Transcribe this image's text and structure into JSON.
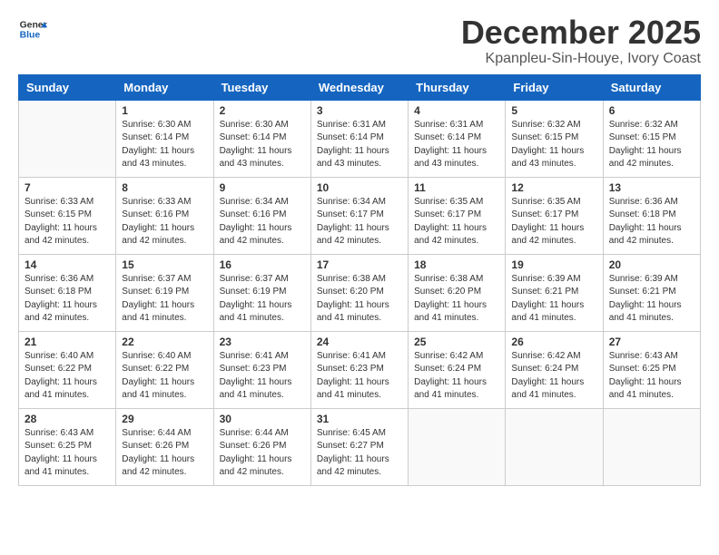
{
  "header": {
    "logo_general": "General",
    "logo_blue": "Blue",
    "title": "December 2025",
    "subtitle": "Kpanpleu-Sin-Houye, Ivory Coast"
  },
  "calendar": {
    "days_of_week": [
      "Sunday",
      "Monday",
      "Tuesday",
      "Wednesday",
      "Thursday",
      "Friday",
      "Saturday"
    ],
    "weeks": [
      [
        {
          "day": "",
          "info": ""
        },
        {
          "day": "1",
          "info": "Sunrise: 6:30 AM\nSunset: 6:14 PM\nDaylight: 11 hours\nand 43 minutes."
        },
        {
          "day": "2",
          "info": "Sunrise: 6:30 AM\nSunset: 6:14 PM\nDaylight: 11 hours\nand 43 minutes."
        },
        {
          "day": "3",
          "info": "Sunrise: 6:31 AM\nSunset: 6:14 PM\nDaylight: 11 hours\nand 43 minutes."
        },
        {
          "day": "4",
          "info": "Sunrise: 6:31 AM\nSunset: 6:14 PM\nDaylight: 11 hours\nand 43 minutes."
        },
        {
          "day": "5",
          "info": "Sunrise: 6:32 AM\nSunset: 6:15 PM\nDaylight: 11 hours\nand 43 minutes."
        },
        {
          "day": "6",
          "info": "Sunrise: 6:32 AM\nSunset: 6:15 PM\nDaylight: 11 hours\nand 42 minutes."
        }
      ],
      [
        {
          "day": "7",
          "info": "Sunrise: 6:33 AM\nSunset: 6:15 PM\nDaylight: 11 hours\nand 42 minutes."
        },
        {
          "day": "8",
          "info": "Sunrise: 6:33 AM\nSunset: 6:16 PM\nDaylight: 11 hours\nand 42 minutes."
        },
        {
          "day": "9",
          "info": "Sunrise: 6:34 AM\nSunset: 6:16 PM\nDaylight: 11 hours\nand 42 minutes."
        },
        {
          "day": "10",
          "info": "Sunrise: 6:34 AM\nSunset: 6:17 PM\nDaylight: 11 hours\nand 42 minutes."
        },
        {
          "day": "11",
          "info": "Sunrise: 6:35 AM\nSunset: 6:17 PM\nDaylight: 11 hours\nand 42 minutes."
        },
        {
          "day": "12",
          "info": "Sunrise: 6:35 AM\nSunset: 6:17 PM\nDaylight: 11 hours\nand 42 minutes."
        },
        {
          "day": "13",
          "info": "Sunrise: 6:36 AM\nSunset: 6:18 PM\nDaylight: 11 hours\nand 42 minutes."
        }
      ],
      [
        {
          "day": "14",
          "info": "Sunrise: 6:36 AM\nSunset: 6:18 PM\nDaylight: 11 hours\nand 42 minutes."
        },
        {
          "day": "15",
          "info": "Sunrise: 6:37 AM\nSunset: 6:19 PM\nDaylight: 11 hours\nand 41 minutes."
        },
        {
          "day": "16",
          "info": "Sunrise: 6:37 AM\nSunset: 6:19 PM\nDaylight: 11 hours\nand 41 minutes."
        },
        {
          "day": "17",
          "info": "Sunrise: 6:38 AM\nSunset: 6:20 PM\nDaylight: 11 hours\nand 41 minutes."
        },
        {
          "day": "18",
          "info": "Sunrise: 6:38 AM\nSunset: 6:20 PM\nDaylight: 11 hours\nand 41 minutes."
        },
        {
          "day": "19",
          "info": "Sunrise: 6:39 AM\nSunset: 6:21 PM\nDaylight: 11 hours\nand 41 minutes."
        },
        {
          "day": "20",
          "info": "Sunrise: 6:39 AM\nSunset: 6:21 PM\nDaylight: 11 hours\nand 41 minutes."
        }
      ],
      [
        {
          "day": "21",
          "info": "Sunrise: 6:40 AM\nSunset: 6:22 PM\nDaylight: 11 hours\nand 41 minutes."
        },
        {
          "day": "22",
          "info": "Sunrise: 6:40 AM\nSunset: 6:22 PM\nDaylight: 11 hours\nand 41 minutes."
        },
        {
          "day": "23",
          "info": "Sunrise: 6:41 AM\nSunset: 6:23 PM\nDaylight: 11 hours\nand 41 minutes."
        },
        {
          "day": "24",
          "info": "Sunrise: 6:41 AM\nSunset: 6:23 PM\nDaylight: 11 hours\nand 41 minutes."
        },
        {
          "day": "25",
          "info": "Sunrise: 6:42 AM\nSunset: 6:24 PM\nDaylight: 11 hours\nand 41 minutes."
        },
        {
          "day": "26",
          "info": "Sunrise: 6:42 AM\nSunset: 6:24 PM\nDaylight: 11 hours\nand 41 minutes."
        },
        {
          "day": "27",
          "info": "Sunrise: 6:43 AM\nSunset: 6:25 PM\nDaylight: 11 hours\nand 41 minutes."
        }
      ],
      [
        {
          "day": "28",
          "info": "Sunrise: 6:43 AM\nSunset: 6:25 PM\nDaylight: 11 hours\nand 41 minutes."
        },
        {
          "day": "29",
          "info": "Sunrise: 6:44 AM\nSunset: 6:26 PM\nDaylight: 11 hours\nand 42 minutes."
        },
        {
          "day": "30",
          "info": "Sunrise: 6:44 AM\nSunset: 6:26 PM\nDaylight: 11 hours\nand 42 minutes."
        },
        {
          "day": "31",
          "info": "Sunrise: 6:45 AM\nSunset: 6:27 PM\nDaylight: 11 hours\nand 42 minutes."
        },
        {
          "day": "",
          "info": ""
        },
        {
          "day": "",
          "info": ""
        },
        {
          "day": "",
          "info": ""
        }
      ]
    ]
  }
}
